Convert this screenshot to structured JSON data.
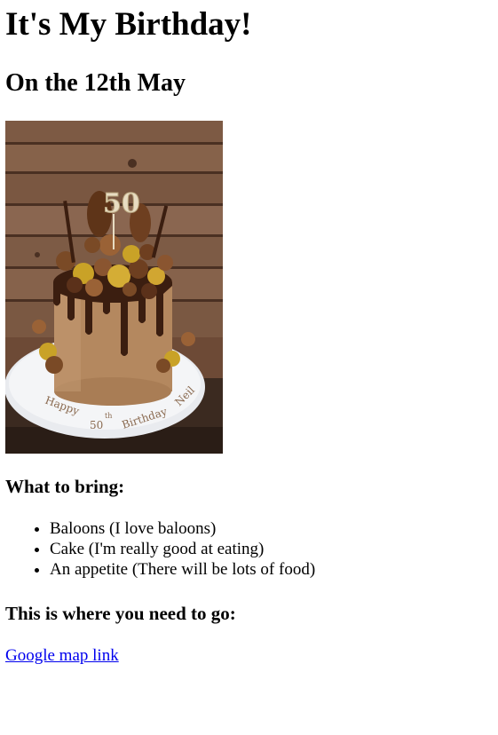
{
  "title": "It's My Birthday!",
  "subtitle": "On the 12th May",
  "cake_image": {
    "topper_text": "50",
    "plate_text": [
      "Happy",
      "50",
      "th",
      "Birthday",
      "Neil"
    ]
  },
  "bring_heading": "What to bring:",
  "bring_items": [
    "Baloons (I love baloons)",
    "Cake (I'm really good at eating)",
    "An appetite (There will be lots of food)"
  ],
  "go_heading": "This is where you need to go:",
  "map_link": "Google map link",
  "colors": {
    "link": "#0000ee",
    "text": "#000000"
  }
}
